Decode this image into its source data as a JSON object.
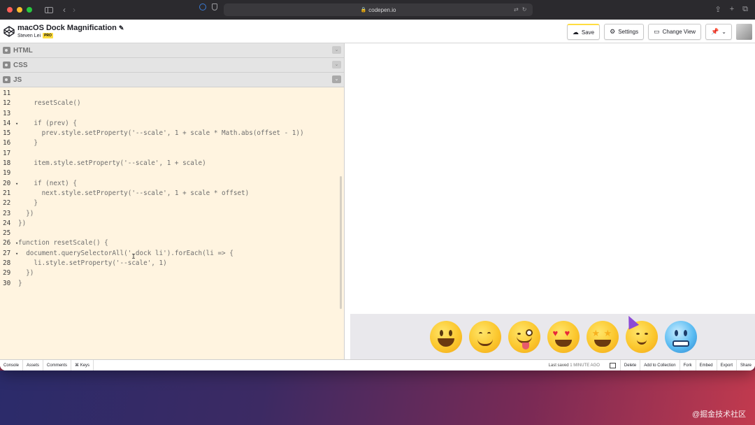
{
  "browser": {
    "url": "codepen.io"
  },
  "header": {
    "title": "macOS Dock Magnification",
    "author": "Steven Lei",
    "badge": "PRO",
    "buttons": {
      "save": "Save",
      "settings": "Settings",
      "change_view": "Change View"
    }
  },
  "panes": {
    "html": "HTML",
    "css": "CSS",
    "js": "JS"
  },
  "code": {
    "lines": [
      {
        "n": "11",
        "fold": false,
        "text": ""
      },
      {
        "n": "12",
        "fold": false,
        "text": "    resetScale()"
      },
      {
        "n": "13",
        "fold": false,
        "text": ""
      },
      {
        "n": "14",
        "fold": true,
        "text": "    if (prev) {"
      },
      {
        "n": "15",
        "fold": false,
        "text": "      prev.style.setProperty('--scale', 1 + scale * Math.abs(offset - 1))"
      },
      {
        "n": "16",
        "fold": false,
        "text": "    }"
      },
      {
        "n": "17",
        "fold": false,
        "text": ""
      },
      {
        "n": "18",
        "fold": false,
        "text": "    item.style.setProperty('--scale', 1 + scale)"
      },
      {
        "n": "19",
        "fold": false,
        "text": ""
      },
      {
        "n": "20",
        "fold": true,
        "text": "    if (next) {"
      },
      {
        "n": "21",
        "fold": false,
        "text": "      next.style.setProperty('--scale', 1 + scale * offset)"
      },
      {
        "n": "22",
        "fold": false,
        "text": "    }"
      },
      {
        "n": "23",
        "fold": false,
        "text": "  })"
      },
      {
        "n": "24",
        "fold": false,
        "text": "})"
      },
      {
        "n": "25",
        "fold": false,
        "text": ""
      },
      {
        "n": "26",
        "fold": true,
        "text": "function resetScale() {"
      },
      {
        "n": "27",
        "fold": true,
        "text": "  document.querySelectorAll('.dock li').forEach(li => {"
      },
      {
        "n": "28",
        "fold": false,
        "text": "    li.style.setProperty('--scale', 1)"
      },
      {
        "n": "29",
        "fold": false,
        "text": "  })"
      },
      {
        "n": "30",
        "fold": false,
        "text": "}"
      }
    ]
  },
  "dock": {
    "items": [
      "grinning-face",
      "smiling-face",
      "winking-tongue-face",
      "heart-eyes-face",
      "star-struck-face",
      "partying-face",
      "cold-face"
    ]
  },
  "footer": {
    "left": [
      "Console",
      "Assets",
      "Comments",
      "⌘ Keys"
    ],
    "saved_label": "Last saved",
    "saved_time": "1 MINUTE AGO",
    "right": [
      "Delete",
      "Add to Collection",
      "Fork",
      "Embed",
      "Export",
      "Share"
    ]
  },
  "watermark": "@掘金技术社区",
  "colors": {
    "editor_bg": "#fff4e0",
    "pro_badge": "#ffdd40",
    "dock_bg": "#e9e8ec"
  }
}
